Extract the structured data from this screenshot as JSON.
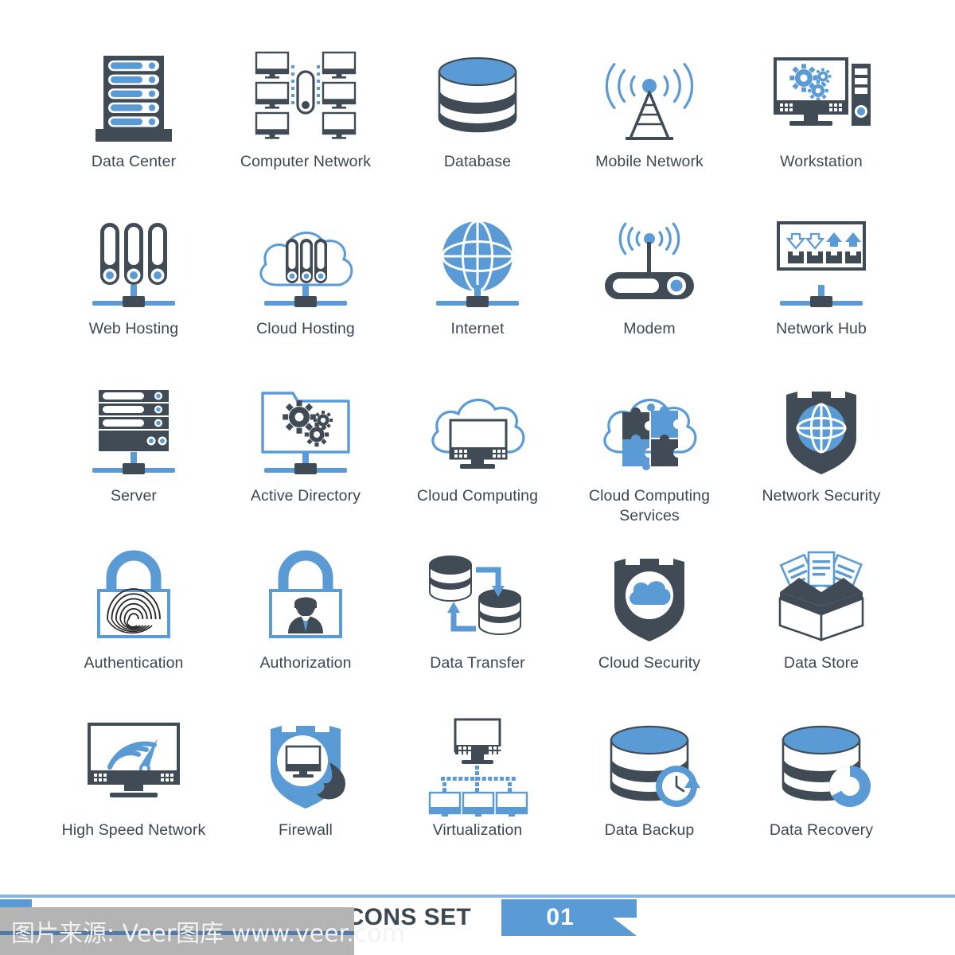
{
  "banner": {
    "title": "DATA AND NETWORKS ICONS SET",
    "number": "01",
    "ribbon_color": "#5b9bd5",
    "rule_color": "#8ab3da"
  },
  "watermark": {
    "text": "图片来源: Veer图库 www.veer.com",
    "bar_color": "#b4b4b4",
    "rule_color": "#3f6fa8"
  },
  "palette": {
    "blue": "#5b9bd5",
    "dark": "#414b56",
    "label": "#3d4752",
    "white": "#ffffff"
  },
  "icons": [
    {
      "id": "data-center",
      "label": "Data Center"
    },
    {
      "id": "computer-network",
      "label": "Computer Network"
    },
    {
      "id": "database",
      "label": "Database"
    },
    {
      "id": "mobile-network",
      "label": "Mobile Network"
    },
    {
      "id": "workstation",
      "label": "Workstation"
    },
    {
      "id": "web-hosting",
      "label": "Web Hosting"
    },
    {
      "id": "cloud-hosting",
      "label": "Cloud Hosting"
    },
    {
      "id": "internet",
      "label": "Internet"
    },
    {
      "id": "modem",
      "label": "Modem"
    },
    {
      "id": "network-hub",
      "label": "Network Hub"
    },
    {
      "id": "server",
      "label": "Server"
    },
    {
      "id": "active-directory",
      "label": "Active Directory"
    },
    {
      "id": "cloud-computing",
      "label": "Cloud Computing"
    },
    {
      "id": "cloud-computing-services",
      "label": "Cloud Computing Services"
    },
    {
      "id": "network-security",
      "label": "Network Security"
    },
    {
      "id": "authentication",
      "label": "Authentication"
    },
    {
      "id": "authorization",
      "label": "Authorization"
    },
    {
      "id": "data-transfer",
      "label": "Data Transfer"
    },
    {
      "id": "cloud-security",
      "label": "Cloud Security"
    },
    {
      "id": "data-store",
      "label": "Data Store"
    },
    {
      "id": "high-speed-network",
      "label": "High Speed Network"
    },
    {
      "id": "firewall",
      "label": "Firewall"
    },
    {
      "id": "virtualization",
      "label": "Virtualization"
    },
    {
      "id": "data-backup",
      "label": "Data Backup"
    },
    {
      "id": "data-recovery",
      "label": "Data Recovery"
    }
  ]
}
